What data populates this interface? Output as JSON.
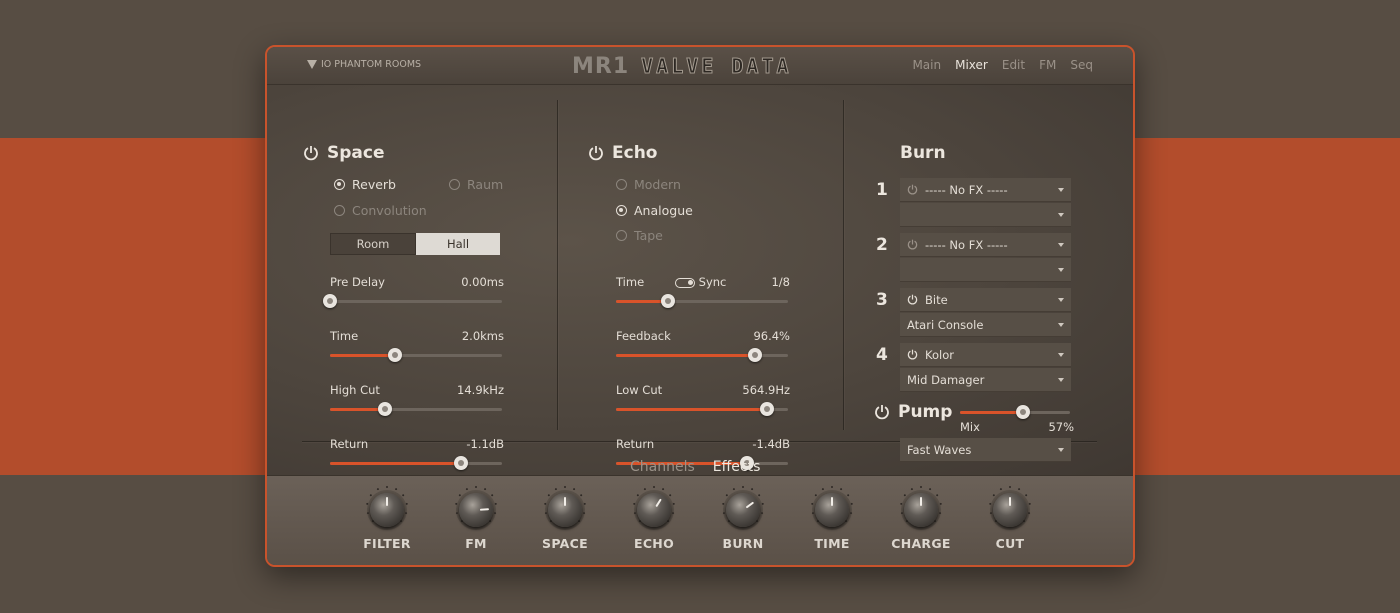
{
  "header": {
    "brand": "IO PHANTOM ROOMS",
    "title_main": "MR1",
    "title_sub": "VALVE DATA",
    "nav": [
      {
        "label": "Main",
        "active": false
      },
      {
        "label": "Mixer",
        "active": true
      },
      {
        "label": "Edit",
        "active": false
      },
      {
        "label": "FM",
        "active": false
      },
      {
        "label": "Seq",
        "active": false
      }
    ]
  },
  "space": {
    "title": "Space",
    "modes": {
      "reverb": "Reverb",
      "raum": "Raum",
      "convolution": "Convolution"
    },
    "selected_mode": "Reverb",
    "seg": {
      "room": "Room",
      "hall": "Hall",
      "selected": "Hall"
    },
    "params": [
      {
        "label": "Pre Delay",
        "value": "0.00ms",
        "level": 0.0
      },
      {
        "label": "Time",
        "value": "2.0kms",
        "level": 0.38
      },
      {
        "label": "High Cut",
        "value": "14.9kHz",
        "level": 0.32
      },
      {
        "label": "Return",
        "value": "-1.1dB",
        "level": 0.76
      }
    ]
  },
  "echo": {
    "title": "Echo",
    "modes": {
      "modern": "Modern",
      "analogue": "Analogue",
      "tape": "Tape"
    },
    "selected_mode": "Analogue",
    "sync_label": "Sync",
    "sync_on": true,
    "params": [
      {
        "label": "Time",
        "value": "1/8",
        "level": 0.3
      },
      {
        "label": "Feedback",
        "value": "96.4%",
        "level": 0.81
      },
      {
        "label": "Low Cut",
        "value": "564.9Hz",
        "level": 0.88
      },
      {
        "label": "Return",
        "value": "-1.4dB",
        "level": 0.76
      }
    ]
  },
  "burn": {
    "title": "Burn",
    "slots": [
      {
        "num": "1",
        "fx": "----- No FX -----",
        "preset": ""
      },
      {
        "num": "2",
        "fx": "----- No FX -----",
        "preset": ""
      },
      {
        "num": "3",
        "fx": "Bite",
        "preset": "Atari Console"
      },
      {
        "num": "4",
        "fx": "Kolor",
        "preset": "Mid Damager"
      }
    ]
  },
  "pump": {
    "title": "Pump",
    "mix_label": "Mix",
    "mix_value": "57%",
    "mix_level": 0.57,
    "preset": "Fast Waves"
  },
  "tabs": [
    {
      "label": "Channels",
      "active": false
    },
    {
      "label": "Effects",
      "active": true
    }
  ],
  "knobs": [
    {
      "label": "FILTER",
      "level": 0.5
    },
    {
      "label": "FM",
      "level": 0.82
    },
    {
      "label": "SPACE",
      "level": 0.5
    },
    {
      "label": "ECHO",
      "level": 0.62
    },
    {
      "label": "BURN",
      "level": 0.7
    },
    {
      "label": "TIME",
      "level": 0.5
    },
    {
      "label": "CHARGE",
      "level": 0.5
    },
    {
      "label": "CUT",
      "level": 0.5
    }
  ],
  "colors": {
    "accent": "#d9532a",
    "band": "#b34d2c",
    "background": "#574d43"
  },
  "icons": {
    "power": "power-icon",
    "caret": "chevron-down-icon",
    "brand": "brand-logo-icon"
  }
}
